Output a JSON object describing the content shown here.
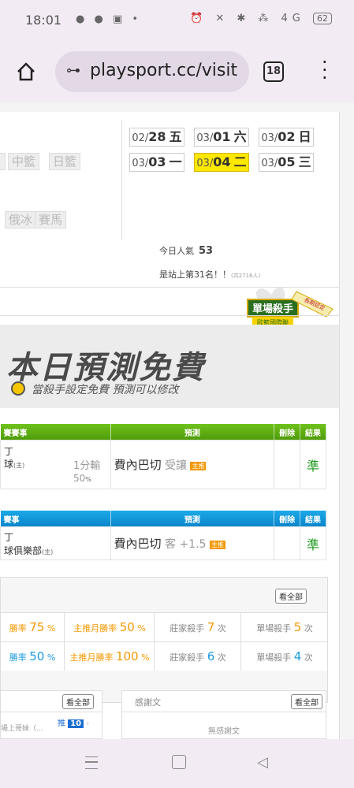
{
  "status_bar": {
    "time": "18:01",
    "left_icons": "● ● ▣ •",
    "right_icons": "⏰ ✕ ✱ ⁂ 4G",
    "battery": "62"
  },
  "browser": {
    "url": "playsport.cc/visit",
    "tab_count": "18",
    "tune_glyph": "⊶"
  },
  "categories": [
    "中籃",
    "日籃",
    "俄冰",
    "賽馬"
  ],
  "dates": [
    {
      "md": "02/",
      "day": "28",
      "wd": "五",
      "active": false
    },
    {
      "md": "03/",
      "day": "01",
      "wd": "六",
      "active": false
    },
    {
      "md": "03/",
      "day": "02",
      "wd": "日",
      "active": false
    },
    {
      "md": "03/",
      "day": "03",
      "wd": "一",
      "active": false
    },
    {
      "md": "03/",
      "day": "04",
      "wd": "二",
      "active": true
    },
    {
      "md": "03/",
      "day": "05",
      "wd": "三",
      "active": false
    }
  ],
  "popularity": {
    "label": "今日人氣",
    "value": "53"
  },
  "rank": {
    "text": "是站上第31名！！",
    "note": "(共2716人)"
  },
  "badge": {
    "line1": "單場殺手",
    "line2": "歐籃國際聯",
    "ribbon": "長期認定"
  },
  "banner": {
    "title": "本日預測免費",
    "subtitle": "當殺手設定免費 預測可以修改"
  },
  "table_green": {
    "headers": [
      "賽賽事",
      "預測",
      "刪除",
      "結果"
    ],
    "row": {
      "line1": "丁",
      "line2": "球",
      "home_tag": "(主)",
      "handicap": "1分輸",
      "percent": "50",
      "percent_unit": "%",
      "team": "費內巴切",
      "bet": "受讓",
      "tag": "主推",
      "result": "準"
    }
  },
  "table_blue": {
    "headers": [
      "賽事",
      "預測",
      "刪除",
      "結果"
    ],
    "row": {
      "line1": "丁",
      "line2": "球俱樂部",
      "home_tag": "(主)",
      "team": "費內巴切",
      "bet": "客 +1.5",
      "tag": "主推",
      "result": "準"
    }
  },
  "stats": {
    "see_all": "看全部",
    "rows": [
      {
        "c1_label": "勝率",
        "c1_val": "75",
        "c1_unit": "%",
        "c2_label": "主推月勝率",
        "c2_val": "50",
        "c2_unit": "%",
        "c3_label": "莊家殺手",
        "c3_val": "7",
        "c3_unit": "次",
        "c4_label": "單場殺手",
        "c4_val": "5",
        "c4_unit": "次"
      },
      {
        "c1_label": "勝率",
        "c1_val": "50",
        "c1_unit": "%",
        "c2_label": "主推月勝率",
        "c2_val": "100",
        "c2_unit": "%",
        "c3_label": "莊家殺手",
        "c3_val": "6",
        "c3_unit": "次",
        "c4_label": "單場殺手",
        "c4_val": "4",
        "c4_unit": "次"
      }
    ]
  },
  "bottom_left": {
    "see_all": "看全部",
    "snippet": "場上哥妹（...",
    "push_label": "推",
    "push_count": "10"
  },
  "thanks": {
    "title": "感謝文",
    "see_all": "看全部",
    "empty": "無感謝文"
  }
}
